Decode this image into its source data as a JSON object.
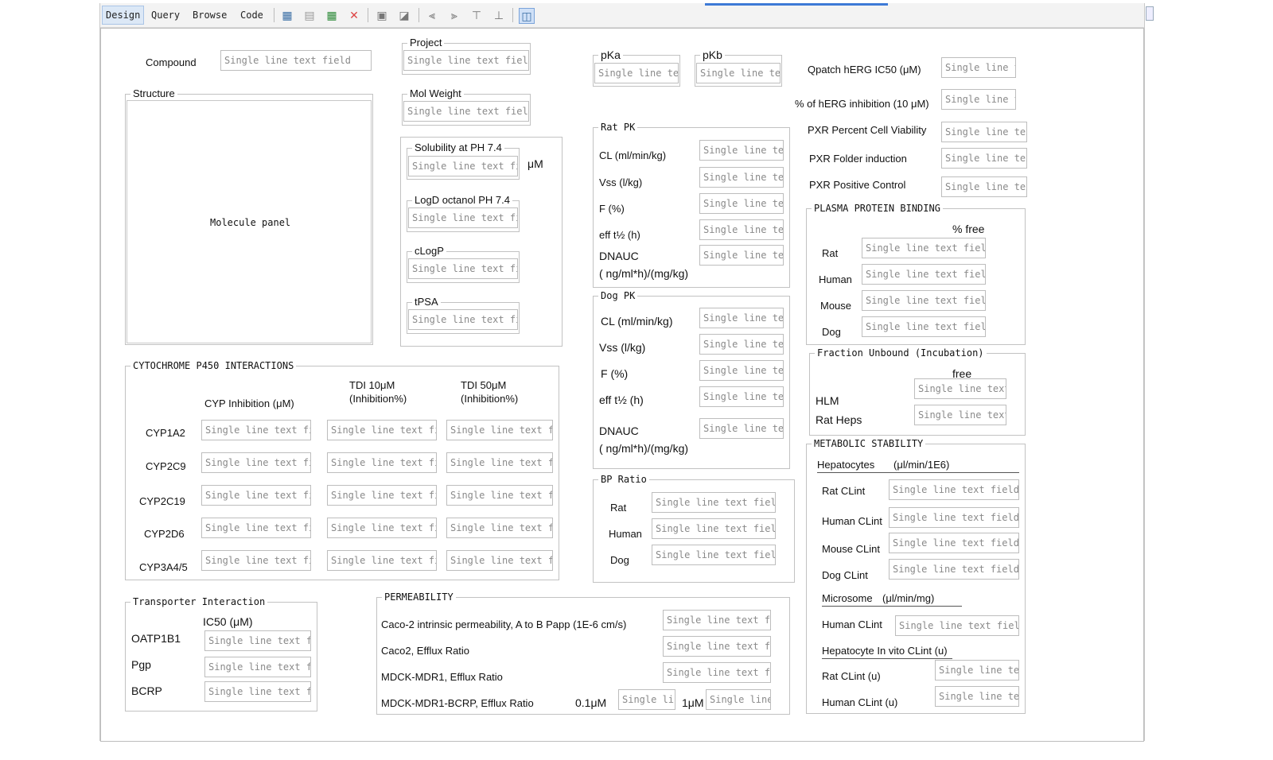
{
  "toolbar": {
    "tabs": [
      "Design",
      "Query",
      "Browse",
      "Code"
    ],
    "icons": [
      "add-table-icon",
      "add-row-icon",
      "add-field-icon",
      "delete-icon",
      "layout-icon",
      "resize-icon",
      "align-left-icon",
      "align-right-icon",
      "align-top-icon",
      "align-bottom-icon",
      "fit-icon"
    ]
  },
  "placeholder": "Single line text field",
  "compound": {
    "label": "Compound"
  },
  "project": {
    "title": "Project"
  },
  "mol_weight": {
    "title": "Mol Weight"
  },
  "pka": {
    "title": "pKa"
  },
  "pkb": {
    "title": "pKb"
  },
  "structure": {
    "title": "Structure",
    "panel_text": "Molecule panel"
  },
  "props": {
    "solubility": "Solubility at PH 7.4",
    "solubility_unit": "μM",
    "logd": "LogD octanol PH 7.4",
    "clogp": "cLogP",
    "tpsa": "tPSA"
  },
  "herg": {
    "ic50": "Qpatch hERG IC50 (μM)",
    "inhibition": "% of hERG inhibition (10 μM)",
    "pxr_viability": "PXR Percent Cell Viability",
    "pxr_folder": "PXR Folder induction",
    "pxr_positive": "PXR Positive Control"
  },
  "rat_pk": {
    "title": "Rat PK",
    "rows": [
      "CL (ml/min/kg)",
      "Vss (l/kg)",
      "F (%)",
      "eff t½ (h)"
    ],
    "dnauc_1": "DNAUC",
    "dnauc_2": "( ng/ml*h)/(mg/kg)"
  },
  "dog_pk": {
    "title": "Dog PK",
    "rows": [
      "CL (ml/min/kg)",
      "Vss (l/kg)",
      "F (%)",
      "eff t½ (h)"
    ],
    "dnauc_1": "DNAUC",
    "dnauc_2": "( ng/ml*h)/(mg/kg)"
  },
  "bp_ratio": {
    "title": "BP Ratio",
    "rows": [
      "Rat",
      "Human",
      "Dog"
    ]
  },
  "ppb": {
    "title": "PLASMA PROTEIN BINDING",
    "header": "% free",
    "rows": [
      "Rat",
      "Human",
      "Mouse",
      "Dog"
    ]
  },
  "fraction_unbound": {
    "title": "Fraction Unbound (Incubation)",
    "header": "free",
    "rows": [
      "HLM",
      "Rat Heps"
    ]
  },
  "cyp": {
    "title": "CYTOCHROME P450 INTERACTIONS",
    "col1": "CYP Inhibition (μM)",
    "col2_1": "TDI 10μM",
    "col2_2": "(Inhibition%)",
    "col3_1": "TDI 50μM",
    "col3_2": "(Inhibition%)",
    "rows": [
      "CYP1A2",
      "CYP2C9",
      "CYP2C19",
      "CYP2D6",
      "CYP3A4/5"
    ]
  },
  "metabolic": {
    "title": "METABOLIC STABILITY",
    "hep_header": "Hepatocytes",
    "hep_unit": "(μl/min/1E6)",
    "hep_rows": [
      "Rat CLint",
      "Human CLint",
      "Mouse CLint",
      "Dog CLint"
    ],
    "micro_header": "Microsome",
    "micro_unit": "(μl/min/mg)",
    "micro_rows": [
      "Human CLint"
    ],
    "invitro_header": "Hepatocyte In vito CLint (u)",
    "invitro_rows": [
      "Rat CLint (u)",
      "Human CLint (u)"
    ]
  },
  "transporter": {
    "title": "Transporter Interaction",
    "header": "IC50 (μM)",
    "rows": [
      "OATP1B1",
      "Pgp",
      "BCRP"
    ]
  },
  "permeability": {
    "title": "PERMEABILITY",
    "rows": [
      "Caco-2 intrinsic permeability, A to B Papp (1E-6 cm/s)",
      "Caco2, Efflux Ratio",
      "MDCK-MDR1, Efflux Ratio",
      "MDCK-MDR1-BCRP, Efflux Ratio"
    ],
    "conc_low": "0.1μM",
    "conc_high": "1μM"
  }
}
